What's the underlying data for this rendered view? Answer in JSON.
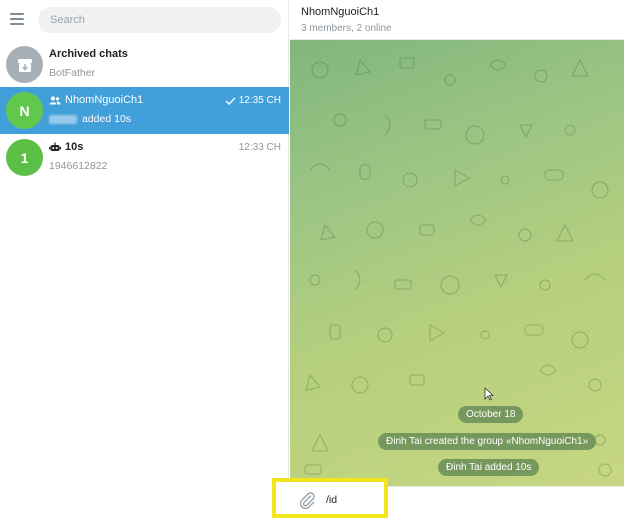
{
  "sidebar": {
    "search": {
      "placeholder": "Search"
    },
    "chats": [
      {
        "title": "Archived chats",
        "subtitle": "BotFather",
        "icon": "archive-icon"
      },
      {
        "avatar_letter": "N",
        "title": "NhomNguoiCh1",
        "subtitle": "added 10s",
        "time": "12:35 CH",
        "icon": "group-icon",
        "status_icon": "check-icon",
        "active": true
      },
      {
        "avatar_letter": "1",
        "title": "10s",
        "subtitle": "1946612822",
        "time": "12:33 CH",
        "icon": "bot-icon"
      }
    ]
  },
  "chat": {
    "title": "NhomNguoiCh1",
    "status": "3 members, 2 online",
    "messages": [
      {
        "type": "date",
        "text": "October 18"
      },
      {
        "type": "service",
        "text": "Đinh Tai created the group «NhomNguoiCh1»"
      },
      {
        "type": "service",
        "text": "Đinh Tai added 10s"
      }
    ],
    "composer": {
      "value": "/id"
    }
  },
  "colors": {
    "accent": "#419fd9",
    "avatar_green": "#5bbf46",
    "highlight": "#f2e51b"
  }
}
